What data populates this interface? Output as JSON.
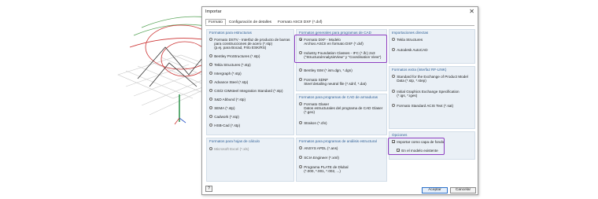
{
  "window": {
    "title": "Importar",
    "close_glyph": "✕"
  },
  "tabs": [
    {
      "label": "Formato"
    },
    {
      "label": "Configuración de detalles"
    },
    {
      "label": "Formato ASCII DXF (*.dxf)"
    }
  ],
  "groups": {
    "structural": {
      "title": "Formatos para estructuras",
      "items": [
        {
          "label": "Formato DSTV - Interfaz de producto de barras",
          "sub": [
            "para construcciones de acero (*.stp)",
            "(p.ej. para Bocad, Frilo ESK/RS)"
          ]
        },
        {
          "label": "Bentley ProStructures (*.stp)"
        },
        {
          "label": "Tekla Structures (*.stp)"
        },
        {
          "label": "Intergraph (*.stp)"
        },
        {
          "label": "Advance Steel (*.stp)"
        },
        {
          "label": "CIS/2 CIMsteel Integration Standard (*.stp)"
        },
        {
          "label": "S&D Abbund (*.stp)"
        },
        {
          "label": "SEMA (*.stp)"
        },
        {
          "label": "Cadwork (*.stp)"
        },
        {
          "label": "HSB-Cad (*.stp)"
        }
      ]
    },
    "spreadsheet": {
      "title": "Formatos para hojas de cálculo",
      "items": [
        {
          "label": "Microsoft Excel (*.xls)"
        }
      ]
    },
    "cad_general": {
      "title": "Formatos generales para programas de CAD",
      "items": [
        {
          "label": "Formato DXF - Modelo",
          "sub": [
            "Archivo ASCII en formato DXF (*.dxf)"
          ],
          "checked": true
        },
        {
          "label": "Industry Foundation Classes - IFC (*.ifc) 2x3",
          "sub": [
            "(\"StructuralAnalysisView\" y \"Coordination View\")"
          ]
        },
        {
          "label": "Bentley ISM (*.ism.dgn, *.dgn)"
        },
        {
          "label": "Formato SDNF",
          "sub": [
            "Steel detailing neutral file (*.sdnf, *.dat)"
          ]
        }
      ]
    },
    "cad_reinf": {
      "title": "Formatos para programas de CAD de armaduras",
      "items": [
        {
          "label": "Formato Glaser",
          "sub": [
            "Datos estructurales del programa de CAD Glaser",
            "(*.geo)"
          ]
        },
        {
          "label": "Strakon (*.cfe)"
        }
      ]
    },
    "analysis": {
      "title": "Formatos para programas de análisis estructural",
      "items": [
        {
          "label": "ANSYS APDL (*.ans)"
        },
        {
          "label": "SCIA Engineer (*.xml)"
        },
        {
          "label": "Programa PLATE de Dlubal",
          "sub": [
            "(*.000, *.001, *.002, ...)"
          ]
        }
      ]
    },
    "direct": {
      "title": "Importaciones directas",
      "items": [
        {
          "label": "Tekla Structures"
        },
        {
          "label": "Autodesk AutoCAD"
        }
      ]
    },
    "extra": {
      "title": "Formatos extra (interfaz RF-LINK)",
      "items": [
        {
          "label": "Standard for the Exchange of Product Model",
          "sub": [
            "Data (*.stp, *.step)"
          ]
        },
        {
          "label": "Initial Graphics Exchange Specification",
          "sub": [
            "(*.igs, *.iges)"
          ]
        },
        {
          "label": "Formato Standard ACIS Text (*.sat)"
        }
      ]
    },
    "options": {
      "title": "Opciones",
      "items": [
        {
          "label": "Importar como capa de fondo",
          "checked": true
        },
        {
          "label": "En el modelo existente",
          "checked": true
        }
      ]
    }
  },
  "buttons": {
    "help_glyph": "?",
    "accept": "Aceptar",
    "cancel": "Cancelar"
  },
  "colors": {
    "group_heading": "#2f5f95",
    "highlight": "#8e3fc1",
    "group_bg": "#eaf0f6"
  }
}
